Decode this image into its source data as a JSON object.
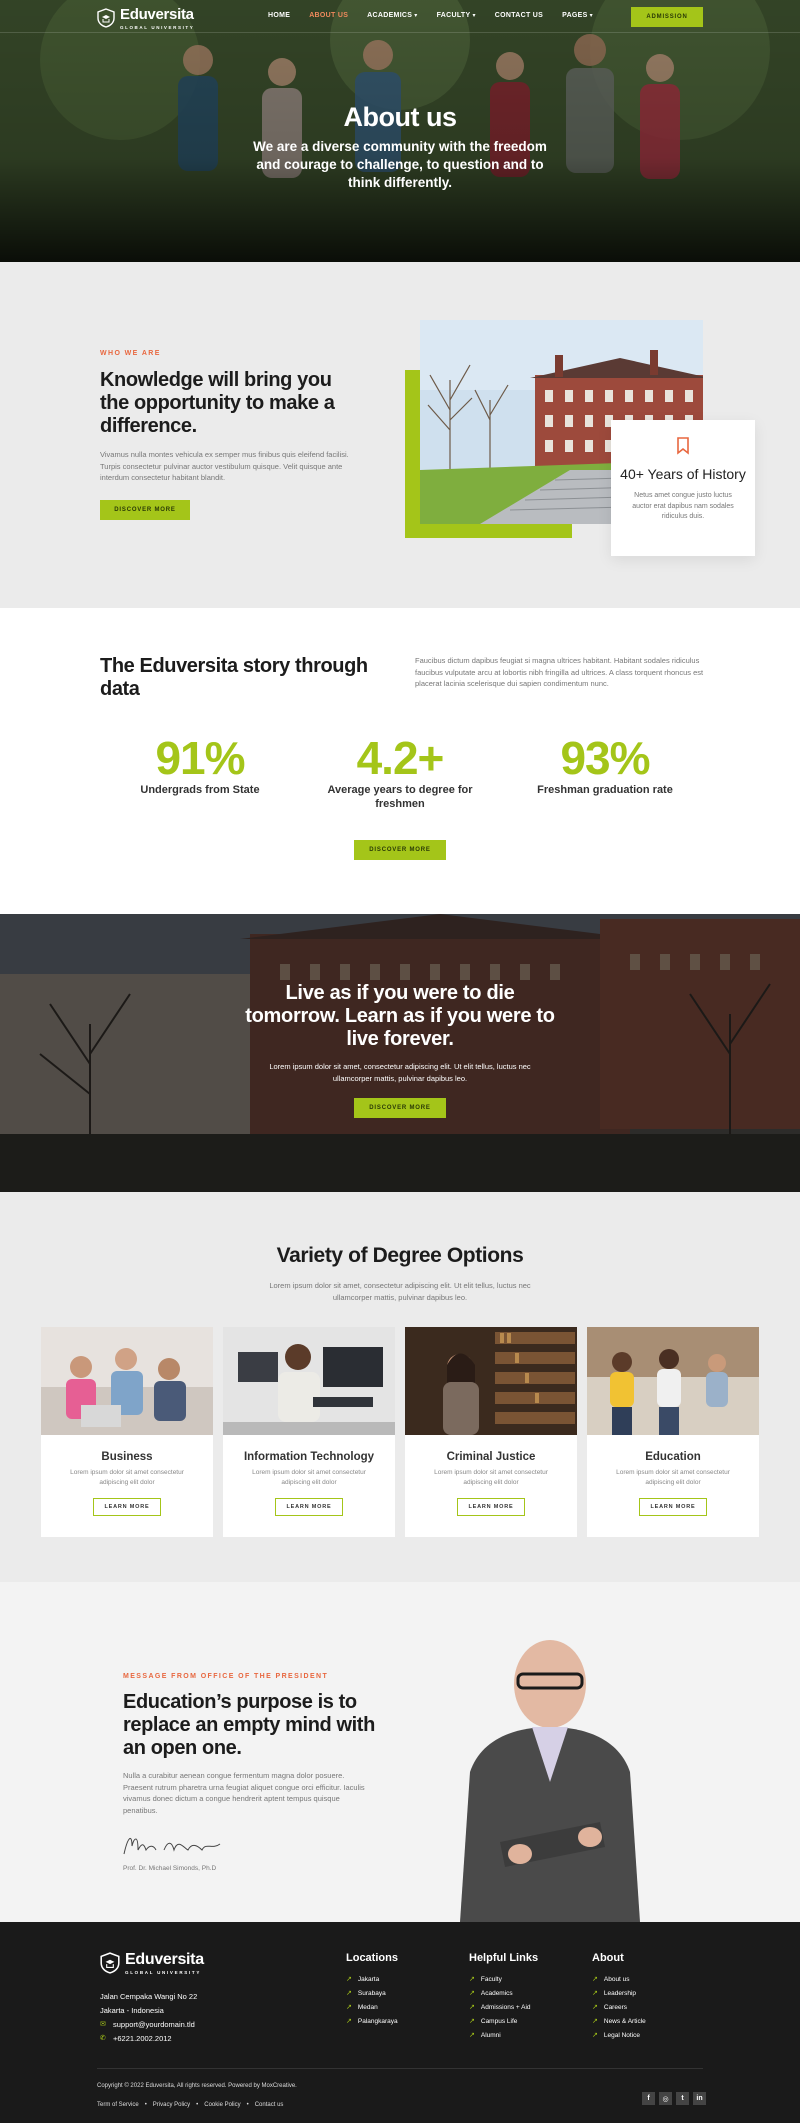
{
  "brand": {
    "name": "Eduversita",
    "tagline": "GLOBAL UNIVERSITY"
  },
  "nav": {
    "items": [
      {
        "label": "HOME",
        "active": false,
        "caret": false
      },
      {
        "label": "ABOUT US",
        "active": true,
        "caret": false
      },
      {
        "label": "ACADEMICS",
        "active": false,
        "caret": true
      },
      {
        "label": "FACULTY",
        "active": false,
        "caret": true
      },
      {
        "label": "CONTACT US",
        "active": false,
        "caret": false
      },
      {
        "label": "PAGES",
        "active": false,
        "caret": true
      }
    ],
    "cta": "ADMISSION"
  },
  "hero": {
    "title": "About us",
    "subtitle": "We are a diverse community with the freedom and courage to challenge, to question and to think differently."
  },
  "who": {
    "eyebrow": "WHO WE ARE",
    "title": "Knowledge will bring you the opportunity to make a difference.",
    "body": "Vivamus nulla montes vehicula ex semper mus finibus quis eleifend facilisi. Turpis consectetur pulvinar auctor vestibulum quisque. Velit quisque ante interdum consectetur habitant blandit.",
    "button": "DISCOVER MORE",
    "card": {
      "icon": "bookmark-icon",
      "title": "40+ Years of History",
      "body": "Netus amet congue justo luctus auctor erat dapibus nam sodales ridiculus duis."
    }
  },
  "story": {
    "title": "The Eduversita story through data",
    "body": "Faucibus dictum dapibus feugiat si magna ultrices habitant. Habitant sodales ridiculus faucibus vulputate arcu at lobortis nibh fringilla ad ultrices. A class torquent rhoncus est placerat lacinia scelerisque dui sapien condimentum nunc.",
    "stats": [
      {
        "value": "91%",
        "label": "Undergrads from State"
      },
      {
        "value": "4.2+",
        "label": "Average years to degree for freshmen"
      },
      {
        "value": "93%",
        "label": "Freshman graduation rate"
      }
    ],
    "button": "DISCOVER MORE"
  },
  "quote": {
    "title": "Live as if you were to die tomorrow. Learn as if you were to live forever.",
    "body": "Lorem ipsum dolor sit amet, consectetur adipiscing elit. Ut elit tellus, luctus nec ullamcorper mattis, pulvinar dapibus leo.",
    "button": "DISCOVER MORE"
  },
  "degrees": {
    "title": "Variety of Degree Options",
    "subtitle": "Lorem ipsum dolor sit amet, consectetur adipiscing elit. Ut elit tellus, luctus nec ullamcorper mattis, pulvinar dapibus leo.",
    "cards": [
      {
        "title": "Business",
        "body": "Lorem ipsum dolor sit amet consectetur adipiscing elit dolor",
        "button": "LEARN MORE"
      },
      {
        "title": "Information Technology",
        "body": "Lorem ipsum dolor sit amet consectetur adipiscing elit dolor",
        "button": "LEARN MORE"
      },
      {
        "title": "Criminal Justice",
        "body": "Lorem ipsum dolor sit amet consectetur adipiscing elit dolor",
        "button": "LEARN MORE"
      },
      {
        "title": "Education",
        "body": "Lorem ipsum dolor sit amet consectetur adipiscing elit dolor",
        "button": "LEARN MORE"
      }
    ]
  },
  "president": {
    "eyebrow": "MESSAGE FROM OFFICE OF THE PRESIDENT",
    "title": "Education’s purpose is to replace an empty mind with an open one.",
    "body": "Nulla a curabitur aenean congue fermentum magna dolor posuere. Praesent rutrum pharetra urna feugiat aliquet congue orci efficitur. Iaculis vivamus donec dictum a congue hendrerit aptent tempus quisque penatibus.",
    "signature": "Michael Simonds",
    "name": "Prof. Dr. Michael Simonds, Ph.D"
  },
  "footer": {
    "address_line1": "Jalan Cempaka Wangi No 22",
    "address_line2": "Jakarta - Indonesia",
    "email": "support@yourdomain.tld",
    "phone": "+6221.2002.2012",
    "columns": [
      {
        "title": "Locations",
        "links": [
          "Jakarta",
          "Surabaya",
          "Medan",
          "Palangkaraya"
        ]
      },
      {
        "title": "Helpful Links",
        "links": [
          "Faculty",
          "Academics",
          "Admissions + Aid",
          "Campus Life",
          "Alumni"
        ]
      },
      {
        "title": "About",
        "links": [
          "About us",
          "Leadership",
          "Careers",
          "News & Article",
          "Legal Notice"
        ]
      }
    ],
    "copyright": "Copyright © 2022 Eduversita, All rights reserved. Powered by MoxCreative.",
    "legal": [
      "Term of Service",
      "Privacy Policy",
      "Cookie Policy",
      "Contact us"
    ],
    "social": [
      "facebook-icon",
      "instagram-icon",
      "twitter-icon",
      "linkedin-icon"
    ]
  },
  "colors": {
    "accent": "#a4c519",
    "eyebrow": "#e8673f",
    "footer_bg": "#1a1a1a",
    "section_bg": "#ebebeb"
  }
}
